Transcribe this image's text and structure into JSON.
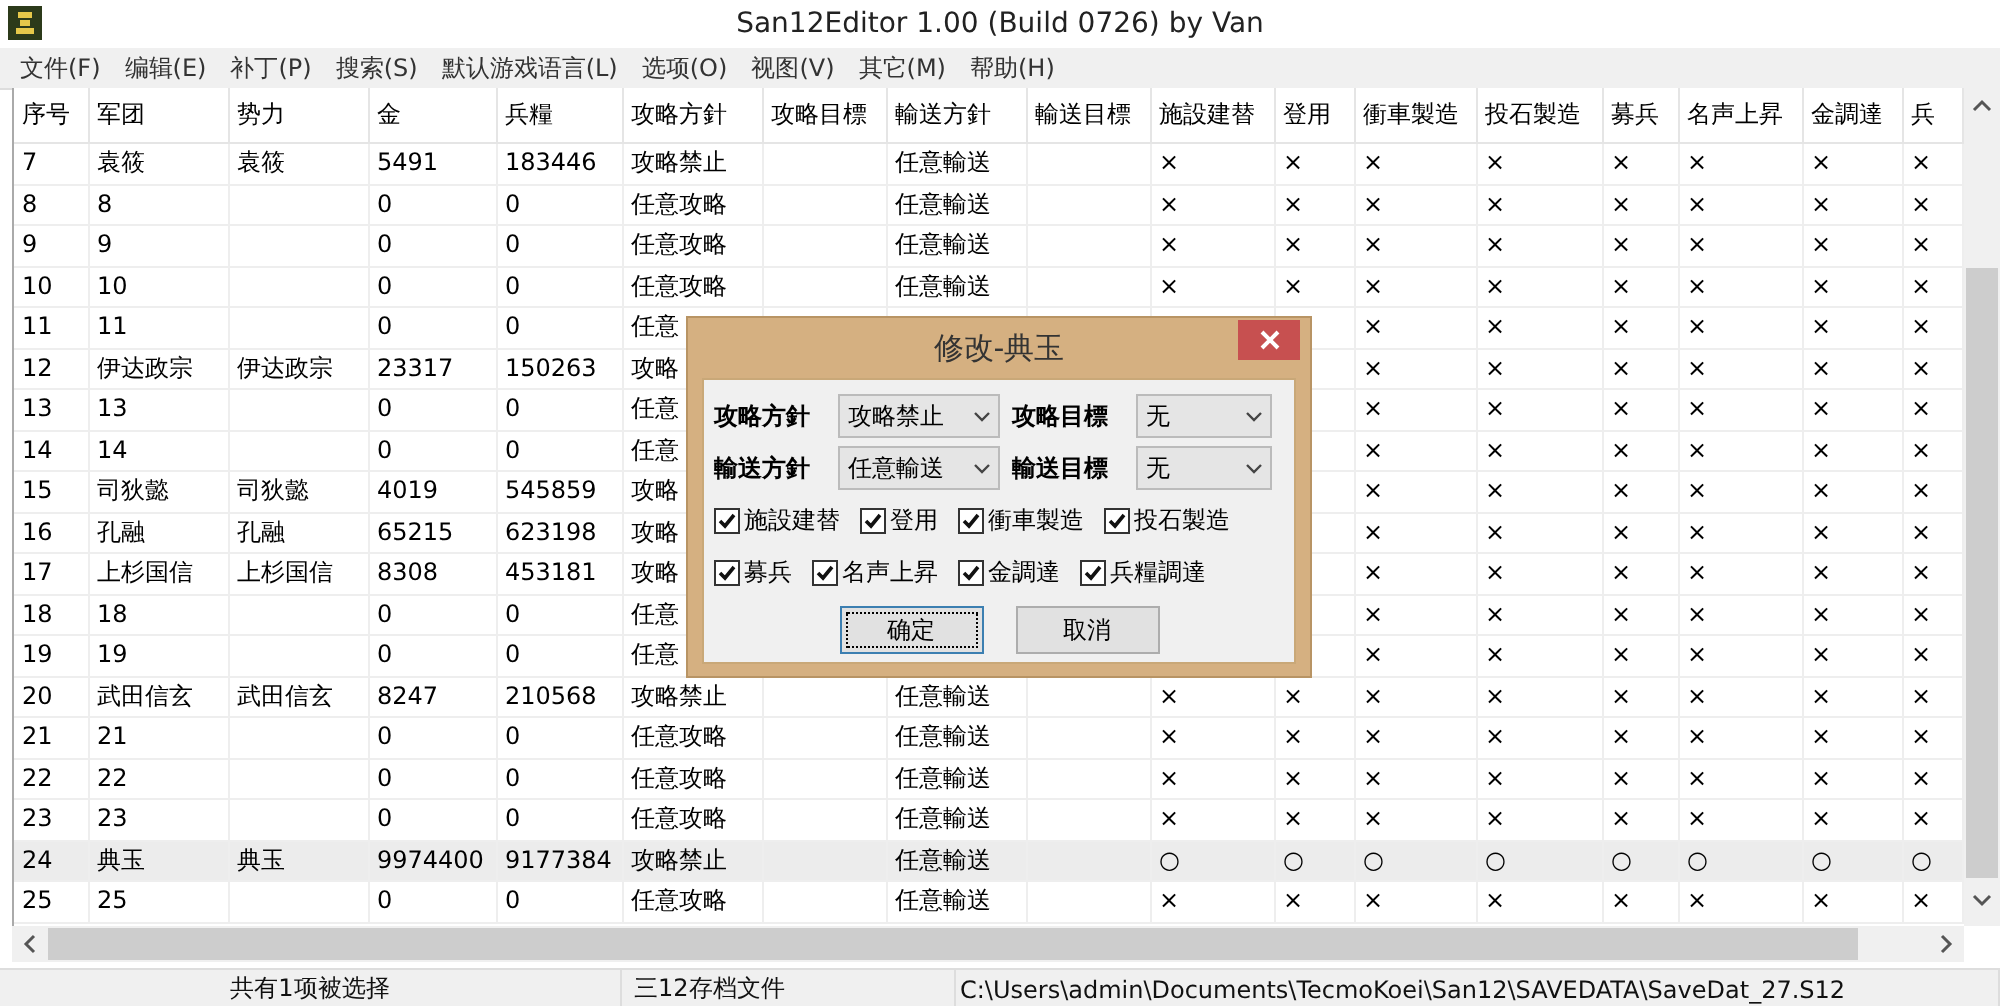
{
  "window": {
    "title": "San12Editor 1.00 (Build 0726) by Van"
  },
  "menu": [
    "文件(F)",
    "编辑(E)",
    "补丁(P)",
    "搜索(S)",
    "默认游戏语言(L)",
    "选项(O)",
    "视图(V)",
    "其它(M)",
    "帮助(H)"
  ],
  "table": {
    "columns": [
      "序号",
      "军团",
      "势力",
      "金",
      "兵糧",
      "攻略方針",
      "攻略目標",
      "輸送方針",
      "輸送目標",
      "施設建替",
      "登用",
      "衝車製造",
      "投石製造",
      "募兵",
      "名声上昇",
      "金調達",
      "兵"
    ],
    "rows": [
      {
        "selected": false,
        "cells": [
          "7",
          "袁筱",
          "袁筱",
          "5491",
          "183446",
          "攻略禁止",
          null,
          "任意輸送",
          null,
          "×",
          "×",
          "×",
          "×",
          "×",
          "×",
          "×",
          "×"
        ]
      },
      {
        "selected": false,
        "cells": [
          "8",
          "8",
          null,
          "0",
          "0",
          "任意攻略",
          null,
          "任意輸送",
          null,
          "×",
          "×",
          "×",
          "×",
          "×",
          "×",
          "×",
          "×"
        ]
      },
      {
        "selected": false,
        "cells": [
          "9",
          "9",
          null,
          "0",
          "0",
          "任意攻略",
          null,
          "任意輸送",
          null,
          "×",
          "×",
          "×",
          "×",
          "×",
          "×",
          "×",
          "×"
        ]
      },
      {
        "selected": false,
        "cells": [
          "10",
          "10",
          null,
          "0",
          "0",
          "任意攻略",
          null,
          "任意輸送",
          null,
          "×",
          "×",
          "×",
          "×",
          "×",
          "×",
          "×",
          "×"
        ]
      },
      {
        "selected": false,
        "cells": [
          "11",
          "11",
          null,
          "0",
          "0",
          "任意",
          null,
          null,
          null,
          null,
          null,
          "×",
          "×",
          "×",
          "×",
          "×",
          "×"
        ]
      },
      {
        "selected": false,
        "cells": [
          "12",
          "伊达政宗",
          "伊达政宗",
          "23317",
          "150263",
          "攻略",
          null,
          null,
          null,
          null,
          null,
          "×",
          "×",
          "×",
          "×",
          "×",
          "×"
        ]
      },
      {
        "selected": false,
        "cells": [
          "13",
          "13",
          null,
          "0",
          "0",
          "任意",
          null,
          null,
          null,
          null,
          null,
          "×",
          "×",
          "×",
          "×",
          "×",
          "×"
        ]
      },
      {
        "selected": false,
        "cells": [
          "14",
          "14",
          null,
          "0",
          "0",
          "任意",
          null,
          null,
          null,
          null,
          null,
          "×",
          "×",
          "×",
          "×",
          "×",
          "×"
        ]
      },
      {
        "selected": false,
        "cells": [
          "15",
          "司狄懿",
          "司狄懿",
          "4019",
          "545859",
          "攻略",
          null,
          null,
          null,
          null,
          null,
          "×",
          "×",
          "×",
          "×",
          "×",
          "×"
        ]
      },
      {
        "selected": false,
        "cells": [
          "16",
          "孔融",
          "孔融",
          "65215",
          "623198",
          "攻略",
          null,
          null,
          null,
          null,
          null,
          "×",
          "×",
          "×",
          "×",
          "×",
          "×"
        ]
      },
      {
        "selected": false,
        "cells": [
          "17",
          "上杉国信",
          "上杉国信",
          "8308",
          "453181",
          "攻略",
          null,
          null,
          null,
          null,
          null,
          "×",
          "×",
          "×",
          "×",
          "×",
          "×"
        ]
      },
      {
        "selected": false,
        "cells": [
          "18",
          "18",
          null,
          "0",
          "0",
          "任意",
          null,
          null,
          null,
          null,
          null,
          "×",
          "×",
          "×",
          "×",
          "×",
          "×"
        ]
      },
      {
        "selected": false,
        "cells": [
          "19",
          "19",
          null,
          "0",
          "0",
          "任意",
          null,
          null,
          null,
          null,
          null,
          "×",
          "×",
          "×",
          "×",
          "×",
          "×"
        ]
      },
      {
        "selected": false,
        "cells": [
          "20",
          "武田信玄",
          "武田信玄",
          "8247",
          "210568",
          "攻略禁止",
          null,
          "任意輸送",
          null,
          "×",
          "×",
          "×",
          "×",
          "×",
          "×",
          "×",
          "×"
        ]
      },
      {
        "selected": false,
        "cells": [
          "21",
          "21",
          null,
          "0",
          "0",
          "任意攻略",
          null,
          "任意輸送",
          null,
          "×",
          "×",
          "×",
          "×",
          "×",
          "×",
          "×",
          "×"
        ]
      },
      {
        "selected": false,
        "cells": [
          "22",
          "22",
          null,
          "0",
          "0",
          "任意攻略",
          null,
          "任意輸送",
          null,
          "×",
          "×",
          "×",
          "×",
          "×",
          "×",
          "×",
          "×"
        ]
      },
      {
        "selected": false,
        "cells": [
          "23",
          "23",
          null,
          "0",
          "0",
          "任意攻略",
          null,
          "任意輸送",
          null,
          "×",
          "×",
          "×",
          "×",
          "×",
          "×",
          "×",
          "×"
        ]
      },
      {
        "selected": true,
        "cells": [
          "24",
          "典玉",
          "典玉",
          "9974400",
          "9177384",
          "攻略禁止",
          null,
          "任意輸送",
          null,
          "○",
          "○",
          "○",
          "○",
          "○",
          "○",
          "○",
          "○"
        ]
      },
      {
        "selected": false,
        "cells": [
          "25",
          "25",
          null,
          "0",
          "0",
          "任意攻略",
          null,
          "任意輸送",
          null,
          "×",
          "×",
          "×",
          "×",
          "×",
          "×",
          "×",
          "×"
        ]
      }
    ]
  },
  "dialog": {
    "title": "修改-典玉",
    "fields": [
      {
        "label": "攻略方針",
        "value": "攻略禁止"
      },
      {
        "label": "攻略目標",
        "value": "无"
      },
      {
        "label": "輸送方針",
        "value": "任意輸送"
      },
      {
        "label": "輸送目標",
        "value": "无"
      }
    ],
    "options": [
      {
        "label": "施設建替",
        "checked": true
      },
      {
        "label": "登用",
        "checked": true
      },
      {
        "label": "衝車製造",
        "checked": true
      },
      {
        "label": "投石製造",
        "checked": true
      },
      {
        "label": "募兵",
        "checked": true
      },
      {
        "label": "名声上昇",
        "checked": true
      },
      {
        "label": "金調達",
        "checked": true
      },
      {
        "label": "兵糧調達",
        "checked": true
      }
    ],
    "buttons": [
      {
        "label": "确定",
        "focused": true
      },
      {
        "label": "取消",
        "focused": false
      }
    ]
  },
  "status_bar": [
    "共有1项被选择",
    "三12存档文件",
    "C:\\Users\\admin\\Documents\\TecmoKoei\\San12\\SAVEDATA\\SaveDat_27.S12"
  ]
}
